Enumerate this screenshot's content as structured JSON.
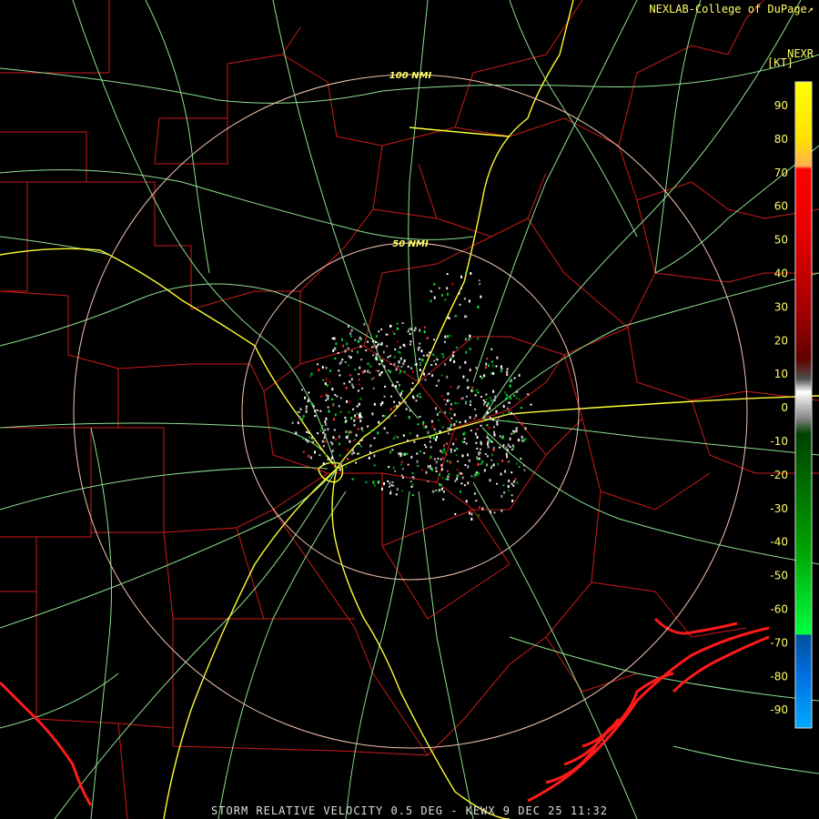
{
  "header": {
    "credit": "NEXLAB-College of DuPage",
    "credit_icon": "external-link-icon",
    "product_code": "NEXR",
    "units": "[KT]"
  },
  "range_rings": [
    {
      "label": "100 NMI"
    },
    {
      "label": "50 NMI"
    }
  ],
  "color_scale": {
    "ticks": [
      "90",
      "80",
      "70",
      "60",
      "50",
      "40",
      "30",
      "20",
      "10",
      "0",
      "-10",
      "-20",
      "-30",
      "-40",
      "-50",
      "-60",
      "-70",
      "-80",
      "-90"
    ],
    "colors": {
      "inbound_strong": "#ffff00",
      "inbound_mid": "#ff0000",
      "inbound_weak": "#600000",
      "neutral": "#ffffff",
      "outbound_weak": "#006000",
      "outbound_mid": "#00ff40",
      "outbound_strong": "#0070ff",
      "outbound_max": "#00aaff"
    }
  },
  "map_colors": {
    "county_lines": "#cc0000",
    "highways_state": "#88dd88",
    "interstates": "#ffff33",
    "coastline": "#ff1a1a",
    "range_rings": "#f5c6b0"
  },
  "caption": "STORM RELATIVE VELOCITY 0.5 DEG - KEWX 9 DEC 25 11:32"
}
